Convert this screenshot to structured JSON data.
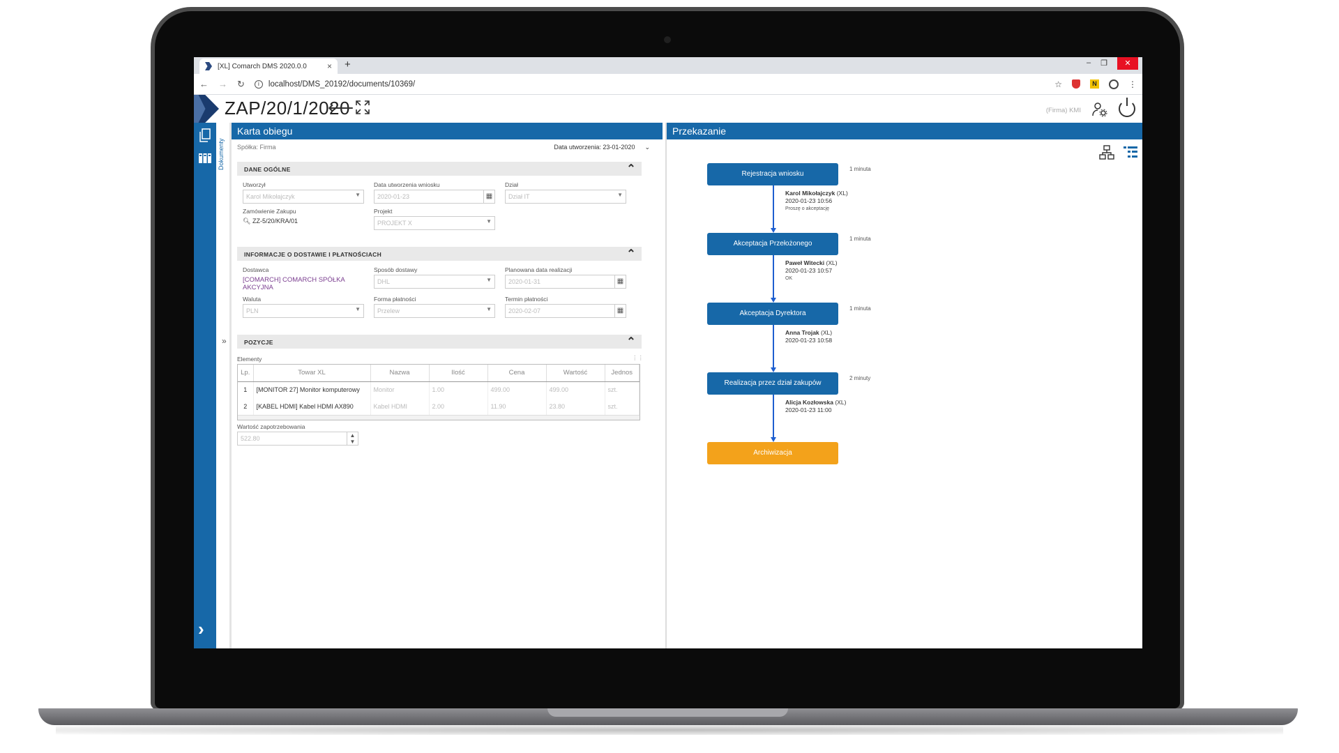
{
  "browser": {
    "tab_title": "[XL] Comarch DMS 2020.0.0",
    "tab_close": "×",
    "new_tab": "+",
    "url": "localhost/DMS_20192/documents/10369/",
    "win_min": "‒",
    "win_max": "❐",
    "win_close": "✕"
  },
  "header": {
    "doc_number": "ZAP/20/1/2020",
    "back": "⟵",
    "user_firm": "(Firma) KMI"
  },
  "sidebar": {
    "vertical_tab": "Dokumenty",
    "collapse": "»"
  },
  "karta": {
    "title": "Karta obiegu",
    "company": "Spółka: Firma",
    "created": "Data utworzenia: 23-01-2020",
    "expand": "⌄",
    "sections": {
      "dane_ogolne": "DANE OGÓLNE",
      "dostawa": "INFORMACJE O DOSTAWIE I PŁATNOŚCIACH",
      "pozycje": "POZYCJE"
    },
    "fields": {
      "utworzyl_label": "Utworzył",
      "utworzyl_value": "Karol Mikołajczyk",
      "data_wniosku_label": "Data utworzenia wniosku",
      "data_wniosku_value": "2020-01-23",
      "dzial_label": "Dział",
      "dzial_value": "Dział IT",
      "zamowienie_label": "Zamówienie Zakupu",
      "zamowienie_value": "ZZ-5/20/KRA/01",
      "projekt_label": "Projekt",
      "projekt_value": "PROJEKT X",
      "dostawca_label": "Dostawca",
      "dostawca_value": "[COMARCH] COMARCH SPÓŁKA AKCYJNA",
      "sposob_label": "Sposób dostawy",
      "sposob_value": "DHL",
      "planowana_label": "Planowana data realizacji",
      "planowana_value": "2020-01-31",
      "waluta_label": "Waluta",
      "waluta_value": "PLN",
      "forma_label": "Forma płatności",
      "forma_value": "Przelew",
      "termin_label": "Termin płatności",
      "termin_value": "2020-02-07"
    },
    "pozycje": {
      "elements_label": "Elementy",
      "columns": [
        "Lp.",
        "Towar XL",
        "Nazwa",
        "Ilość",
        "Cena",
        "Wartość",
        "Jednos"
      ],
      "rows": [
        {
          "lp": "1",
          "towar": "[MONITOR 27] Monitor komputerowy",
          "nazwa": "Monitor",
          "ilosc": "1.00",
          "cena": "499.00",
          "wartosc": "499.00",
          "jedn": "szt."
        },
        {
          "lp": "2",
          "towar": "[KABEL HDMI] Kabel HDMI AX890",
          "nazwa": "Kabel HDMI",
          "ilosc": "2.00",
          "cena": "11.90",
          "wartosc": "23.80",
          "jedn": "szt."
        }
      ],
      "wartosc_label": "Wartość zapotrzebowania",
      "wartosc_value": "522.80"
    }
  },
  "przekazanie": {
    "title": "Przekazanie",
    "steps": [
      {
        "name": "Rejestracja wniosku",
        "time": "1 minuta",
        "who": "Karol Mikołajczyk",
        "suffix": "(XL)",
        "date": "2020-01-23 10:56",
        "note": "Proszę o akceptację"
      },
      {
        "name": "Akceptacja Przełożonego",
        "time": "1 minuta",
        "who": "Paweł Witecki",
        "suffix": "(XL)",
        "date": "2020-01-23 10:57",
        "note": "OK"
      },
      {
        "name": "Akceptacja Dyrektora",
        "time": "1 minuta",
        "who": "Anna Trojak",
        "suffix": "(XL)",
        "date": "2020-01-23 10:58",
        "note": ""
      },
      {
        "name": "Realizacja przez dział zakupów",
        "time": "2 minuty",
        "who": "Alicja Kozłowska",
        "suffix": "(XL)",
        "date": "2020-01-23 11:00",
        "note": ""
      },
      {
        "name": "Archiwizacja",
        "time": "",
        "who": "",
        "suffix": "",
        "date": "",
        "note": ""
      }
    ]
  },
  "colors": {
    "primary": "#1768a8",
    "archive": "#f3a21b",
    "connector": "#1e5fd0"
  }
}
